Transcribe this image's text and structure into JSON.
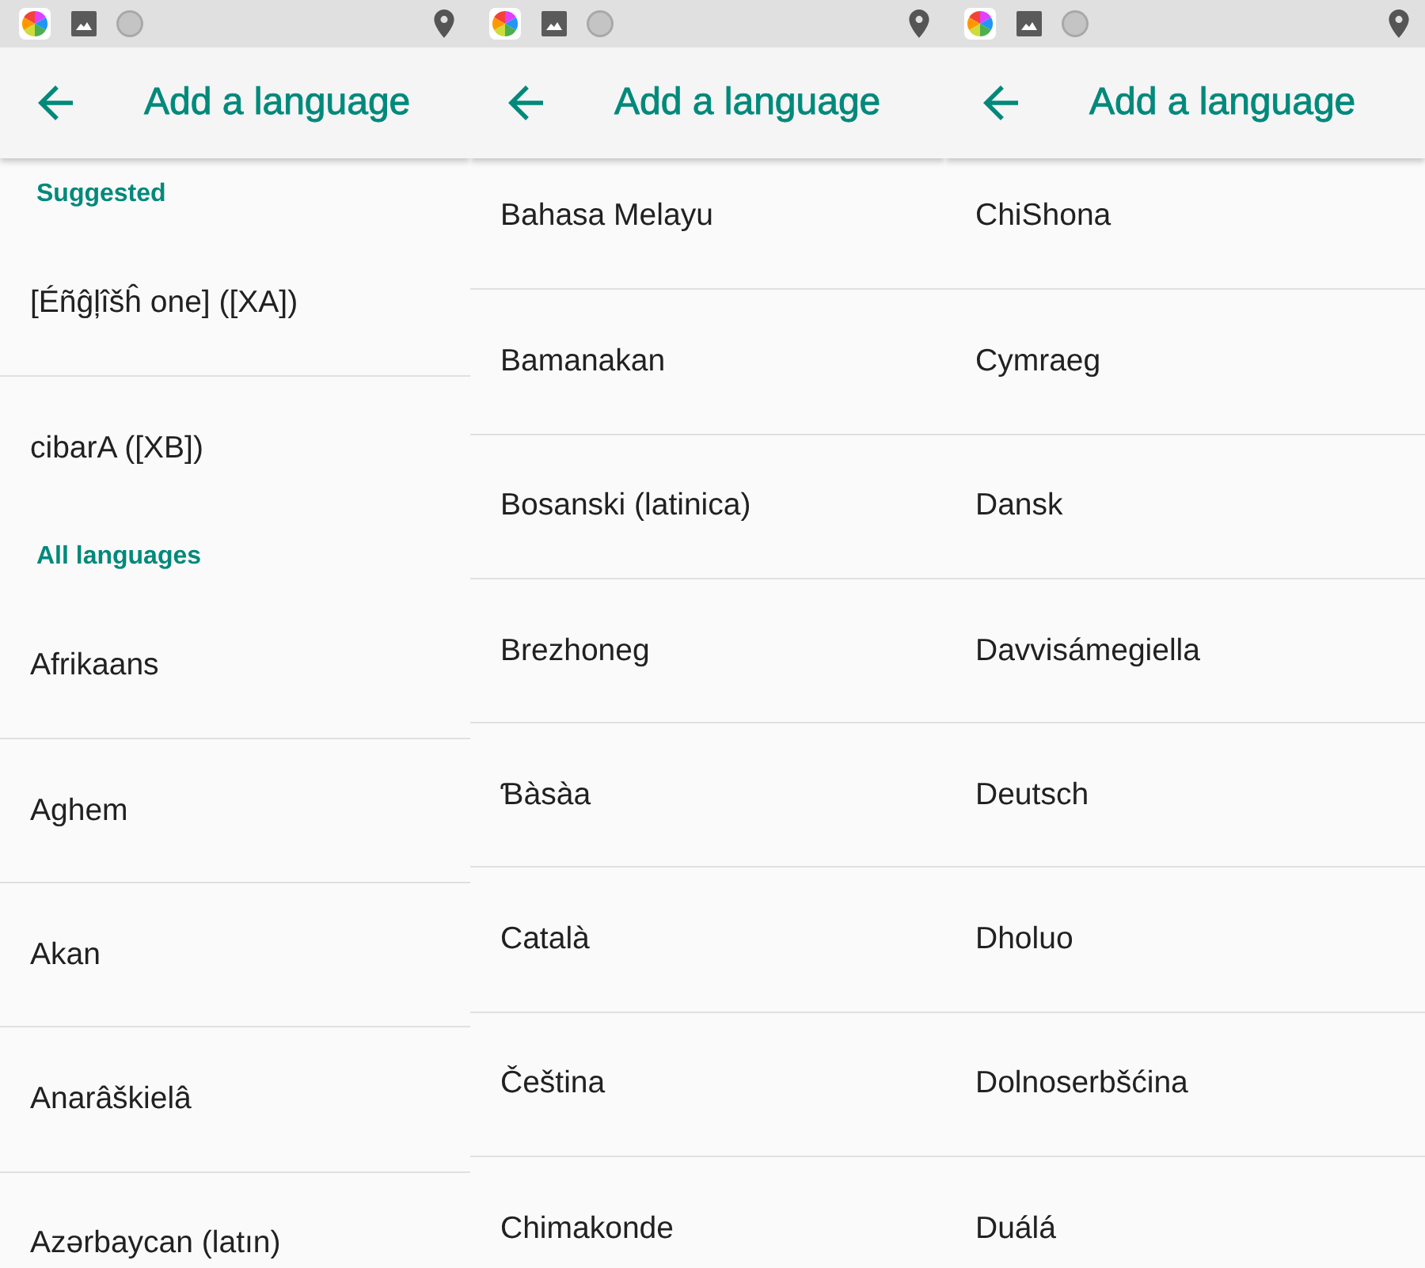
{
  "screens": [
    {
      "app_bar": {
        "title": "Add a language"
      },
      "list": [
        {
          "kind": "header",
          "label": "Suggested"
        },
        {
          "kind": "item",
          "label": "[Éñĝļîšĥ one] ([XA])"
        },
        {
          "kind": "item",
          "label": "cibarA ([XB])"
        },
        {
          "kind": "header",
          "label": "All languages"
        },
        {
          "kind": "item",
          "label": "Afrikaans"
        },
        {
          "kind": "item",
          "label": "Aghem"
        },
        {
          "kind": "item",
          "label": "Akan"
        },
        {
          "kind": "item",
          "label": "Anarâškielâ"
        },
        {
          "kind": "item",
          "label": "Azərbaycan (latın)"
        }
      ]
    },
    {
      "app_bar": {
        "title": "Add a language"
      },
      "list": [
        {
          "kind": "item",
          "label": "Bahasa Melayu"
        },
        {
          "kind": "item",
          "label": "Bamanakan"
        },
        {
          "kind": "item",
          "label": "Bosanski (latinica)"
        },
        {
          "kind": "item",
          "label": "Brezhoneg"
        },
        {
          "kind": "item",
          "label": "Ɓàsàa"
        },
        {
          "kind": "item",
          "label": "Català"
        },
        {
          "kind": "item",
          "label": "Čeština"
        },
        {
          "kind": "item",
          "label": "Chimakonde"
        }
      ]
    },
    {
      "app_bar": {
        "title": "Add a language"
      },
      "list": [
        {
          "kind": "item",
          "label": "ChiShona"
        },
        {
          "kind": "item",
          "label": "Cymraeg"
        },
        {
          "kind": "item",
          "label": "Dansk"
        },
        {
          "kind": "item",
          "label": "Davvisámegiella"
        },
        {
          "kind": "item",
          "label": "Deutsch"
        },
        {
          "kind": "item",
          "label": "Dholuo"
        },
        {
          "kind": "item",
          "label": "Dolnoserbšćina"
        },
        {
          "kind": "item",
          "label": "Duálá"
        }
      ]
    }
  ]
}
